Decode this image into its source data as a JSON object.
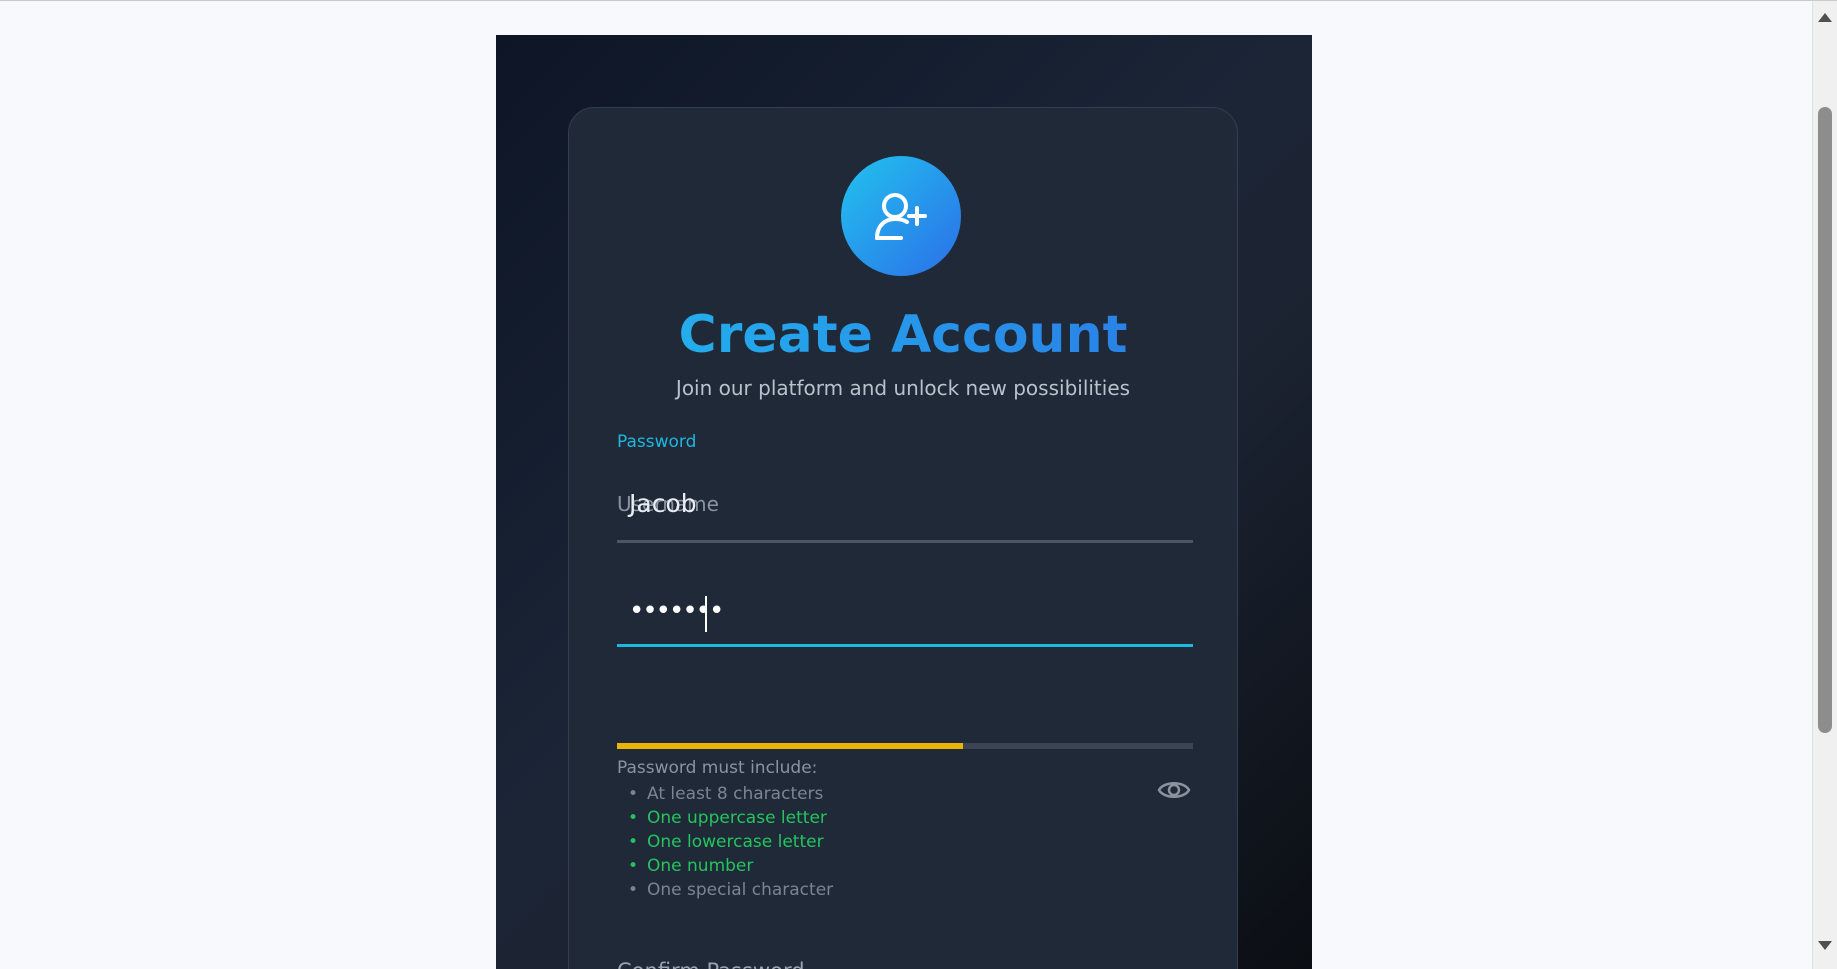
{
  "header": {
    "title": "Create Account",
    "subtitle": "Join our platform and unlock new possibilities",
    "avatar_icon": "user-plus-icon"
  },
  "form": {
    "username": {
      "floating_label": "Password",
      "placeholder": "Username",
      "value": "Jacob"
    },
    "password": {
      "value": "•••••••",
      "strength_fraction": 0.6,
      "strength_color": "#eab308",
      "toggle_icon": "eye-icon",
      "requirements_title": "Password must include:",
      "requirements": [
        {
          "label": "At least 8 characters",
          "met": false
        },
        {
          "label": "One uppercase letter",
          "met": true
        },
        {
          "label": "One lowercase letter",
          "met": true
        },
        {
          "label": "One number",
          "met": true
        },
        {
          "label": "One special character",
          "met": false
        }
      ]
    },
    "confirm_password": {
      "placeholder": "Confirm Password",
      "toggle_icon": "eye-icon"
    }
  },
  "colors": {
    "accent": "#1fb6e0",
    "gradient_start": "#22c3ee",
    "gradient_end": "#2b6fe8",
    "success": "#22c55e",
    "card_bg": "#1f2937"
  }
}
